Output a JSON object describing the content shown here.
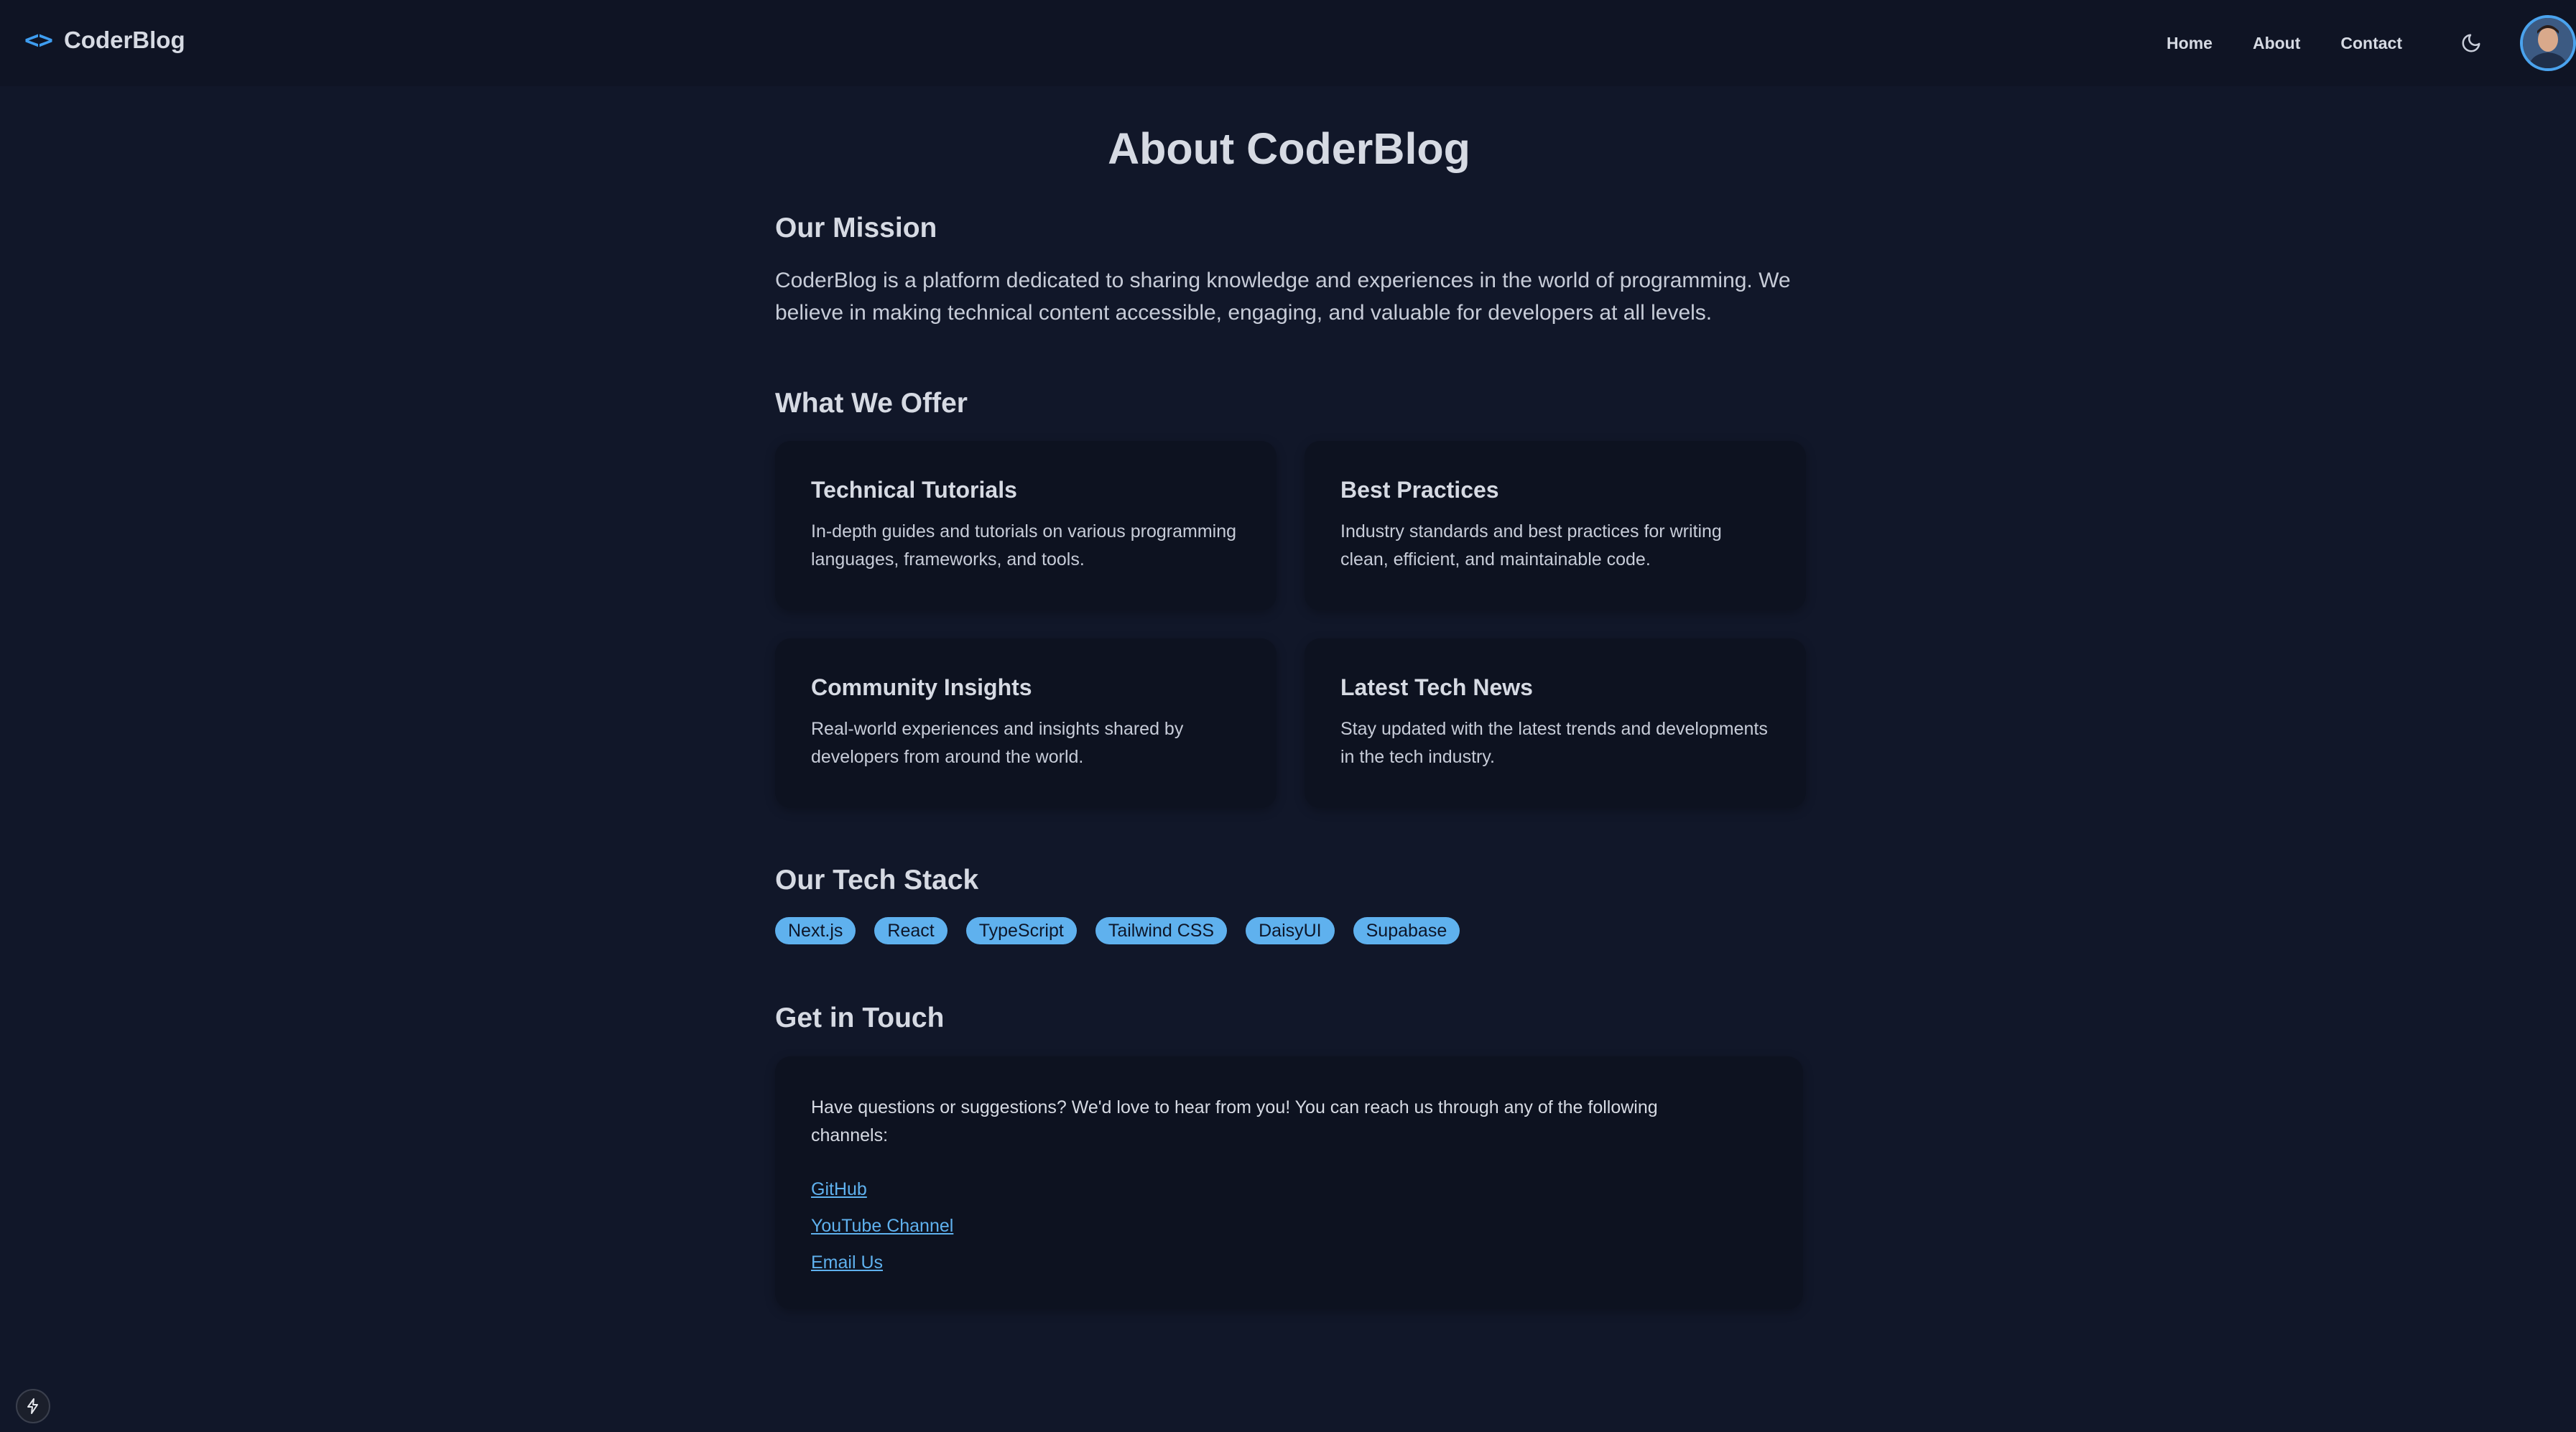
{
  "nav": {
    "brand_icon": "<>",
    "brand_name": "CoderBlog",
    "links": [
      {
        "label": "Home"
      },
      {
        "label": "About"
      },
      {
        "label": "Contact"
      }
    ],
    "theme_icon": "moon-icon",
    "avatar_icon": "user-avatar"
  },
  "page": {
    "title": "About CoderBlog"
  },
  "mission": {
    "heading": "Our Mission",
    "text": "CoderBlog is a platform dedicated to sharing knowledge and experiences in the world of programming. We believe in making technical content accessible, engaging, and valuable for developers at all levels."
  },
  "offer": {
    "heading": "What We Offer",
    "items": [
      {
        "title": "Technical Tutorials",
        "desc": "In-depth guides and tutorials on various programming languages, frameworks, and tools."
      },
      {
        "title": "Best Practices",
        "desc": "Industry standards and best practices for writing clean, efficient, and maintainable code."
      },
      {
        "title": "Community Insights",
        "desc": "Real-world experiences and insights shared by developers from around the world."
      },
      {
        "title": "Latest Tech News",
        "desc": "Stay updated with the latest trends and developments in the tech industry."
      }
    ]
  },
  "tech_stack": {
    "heading": "Our Tech Stack",
    "items": [
      "Next.js",
      "React",
      "TypeScript",
      "Tailwind CSS",
      "DaisyUI",
      "Supabase"
    ]
  },
  "contact": {
    "heading": "Get in Touch",
    "intro": "Have questions or suggestions? We'd love to hear from you! You can reach us through any of the following channels:",
    "links": [
      {
        "label": "GitHub"
      },
      {
        "label": "YouTube Channel"
      },
      {
        "label": "Email Us"
      }
    ]
  },
  "dev_indicator_icon": "lightning-icon",
  "colors": {
    "background": "#111729",
    "navbar": "#0f1424",
    "card": "#0d1220",
    "accent": "#5fb1ee",
    "brand_accent": "#3e9df0",
    "text": "#d6dae3"
  }
}
